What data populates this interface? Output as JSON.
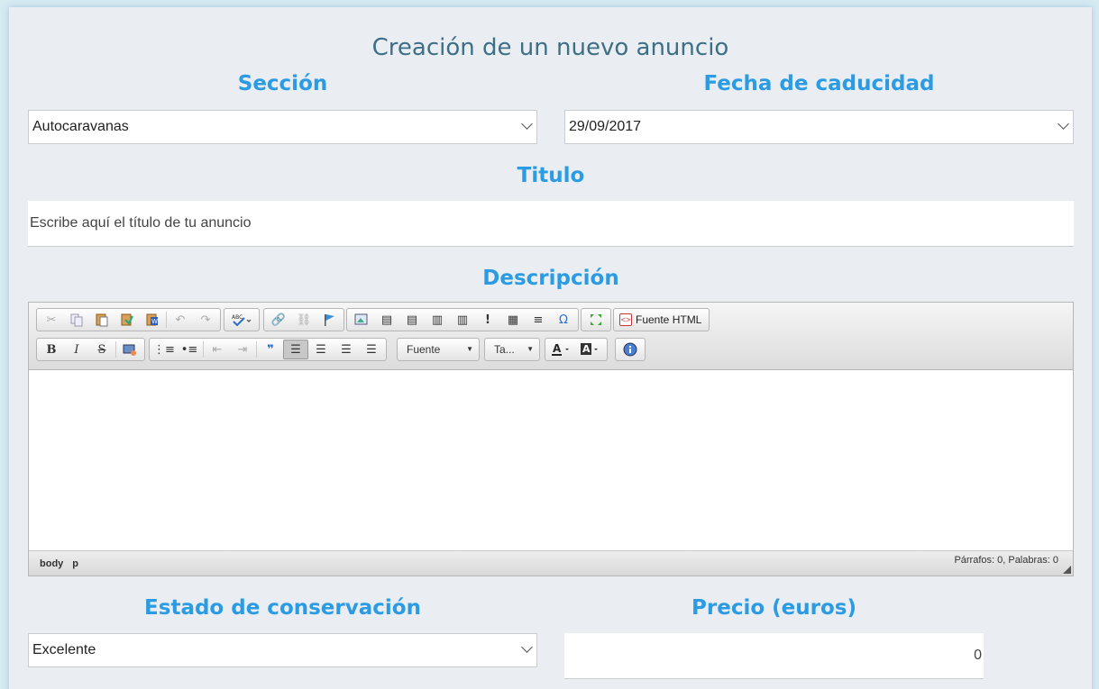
{
  "page": {
    "title": "Creación de un nuevo anuncio"
  },
  "seccion": {
    "label": "Sección",
    "value": "Autocaravanas"
  },
  "fecha": {
    "label": "Fecha de caducidad",
    "value": "29/09/2017"
  },
  "titulo": {
    "label": "Titulo",
    "placeholder": "Escribe aquí el título de tu anuncio"
  },
  "descripcion": {
    "label": "Descripción",
    "toolbar": {
      "source_label": "Fuente HTML",
      "font_combo": "Fuente",
      "size_combo": "Ta...",
      "bold": "B",
      "italic": "I",
      "strike": "S",
      "omega": "Ω",
      "exclaim": "!"
    },
    "status": {
      "path": [
        "body",
        "p"
      ],
      "counts": "Párrafos: 0, Palabras: 0"
    }
  },
  "estado": {
    "label": "Estado de conservación",
    "value": "Excelente"
  },
  "precio": {
    "label": "Precio (euros)",
    "value": "0"
  },
  "colors": {
    "accent": "#2b9be3",
    "title": "#3d6f86",
    "panel": "#eaeef2"
  }
}
